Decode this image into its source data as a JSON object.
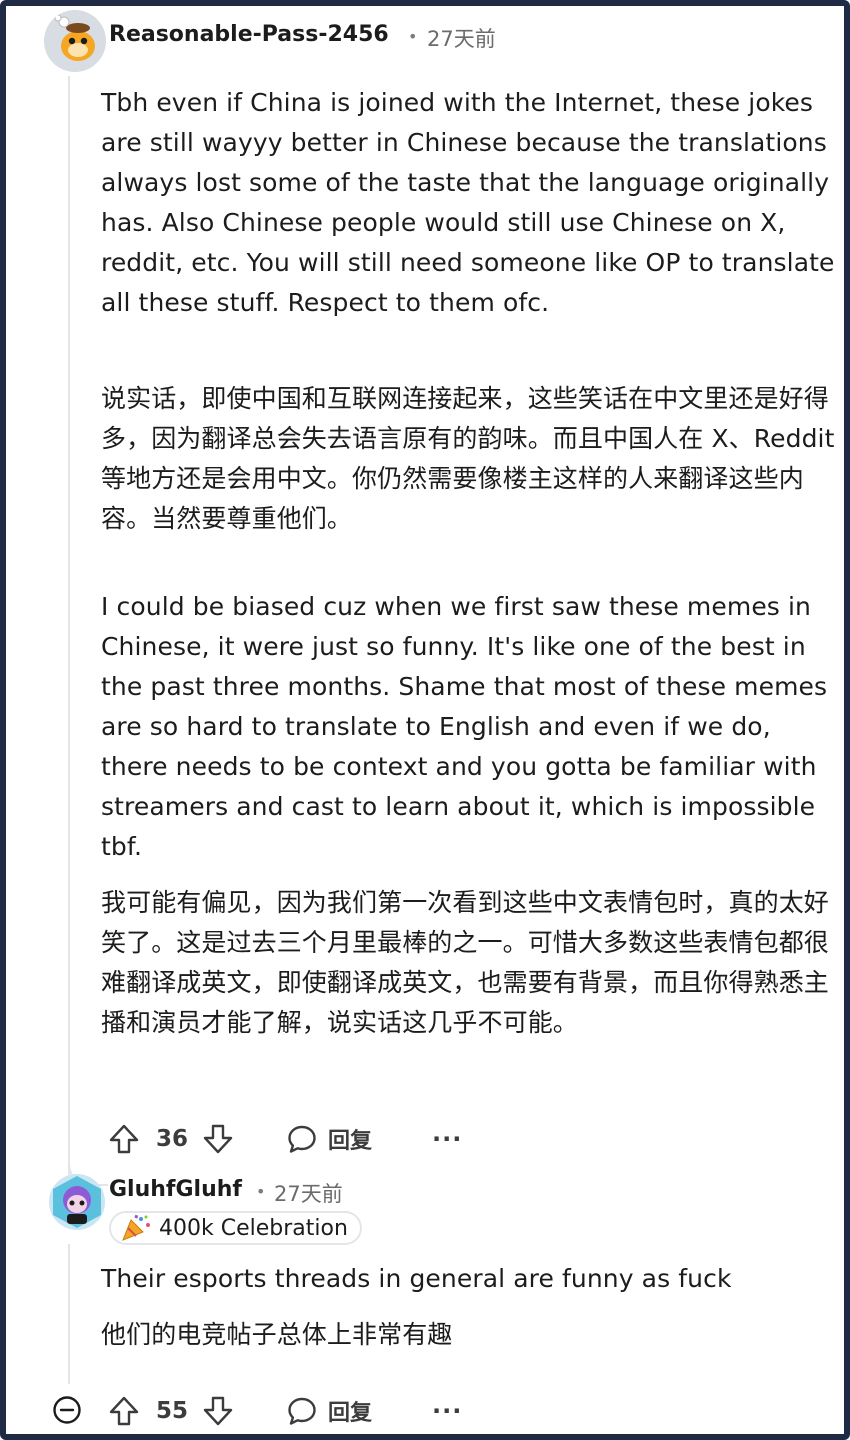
{
  "comments": [
    {
      "username": "Reasonable-Pass-2456",
      "separator": "•",
      "timestamp": "27天前",
      "paragraphs": [
        "Tbh even if China is joined with the Internet, these jokes are still wayyy better in Chinese because the translations always lost some of the taste that the language originally has. Also Chinese people would still use Chinese on X, reddit, etc. You will still need someone like OP to translate all these stuff. Respect to them ofc.",
        "说实话，即使中国和互联网连接起来，这些笑话在中文里还是好得多，因为翻译总会失去语言原有的韵味。而且中国人在 X、Reddit 等地方还是会用中文。你仍然需要像楼主这样的人来翻译这些内容。当然要尊重他们。",
        "I could be biased cuz when we first saw these memes in Chinese, it were just so funny. It's like one of the best in the past three months. Shame that most of these memes are so hard to translate to English and even if we do, there needs to be context and you gotta be familiar with streamers and cast to learn about it, which is impossible tbf.",
        "我可能有偏见，因为我们第一次看到这些中文表情包时，真的太好笑了。这是过去三个月里最棒的之一。可惜大多数这些表情包都很难翻译成英文，即使翻译成英文，也需要有背景，而且你得熟悉主播和演员才能了解，说实话这几乎不可能。"
      ],
      "votes": "36",
      "reply_label": "回复",
      "more_label": "···"
    },
    {
      "username": "GluhfGluhf",
      "separator": "•",
      "timestamp": "27天前",
      "flair": "400k Celebration",
      "paragraphs": [
        "Their esports threads in general are funny as fuck",
        "他们的电竞帖子总体上非常有趣"
      ],
      "votes": "55",
      "reply_label": "回复",
      "more_label": "···"
    }
  ],
  "icons": {
    "upvote": "arrow-up-icon",
    "downvote": "arrow-down-icon",
    "reply": "speech-bubble-icon",
    "collapse": "minus-circle-icon",
    "flair": "party-popper-icon"
  },
  "colors": {
    "text": "#1c1c1c",
    "meta": "#6b6b6b",
    "thread_line": "#e3e6e9",
    "frame": "#1f2a44"
  }
}
